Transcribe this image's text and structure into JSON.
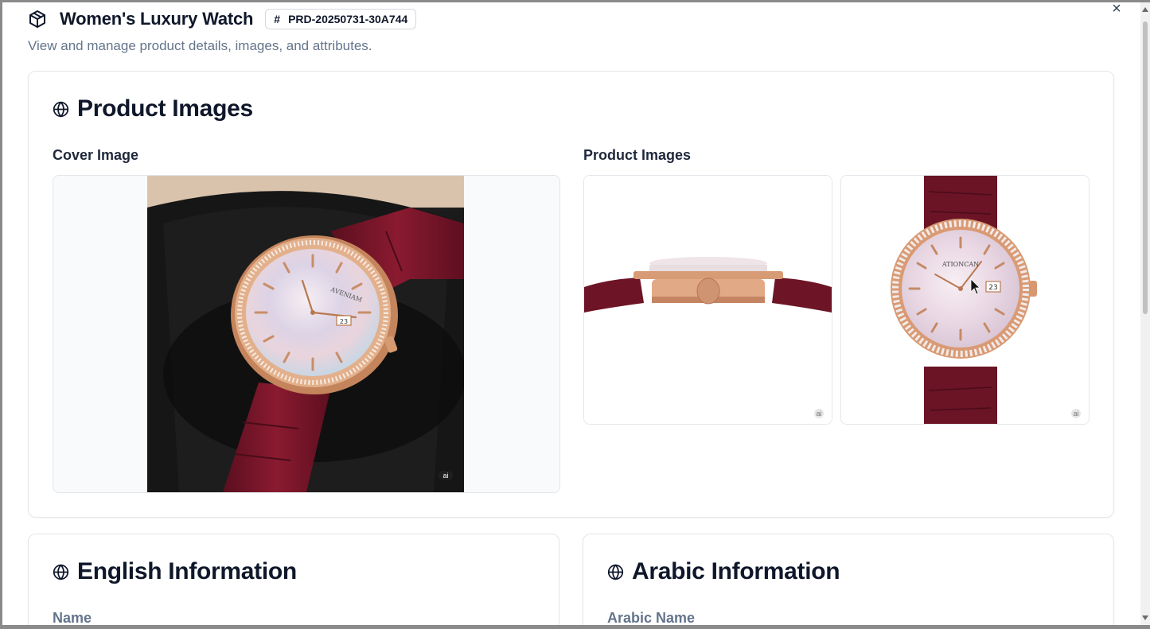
{
  "product": {
    "title": "Women's Luxury Watch",
    "id_badge": "PRD-20250731-30A744",
    "subtitle": "View and manage product details, images, and attributes."
  },
  "images_section": {
    "title": "Product Images",
    "cover_label": "Cover Image",
    "product_images_label": "Product Images",
    "ai_badge": "ai",
    "ai_badge_small": "ai",
    "product_images": [
      {
        "icon": "watch-side-view",
        "ai_badge": "ai"
      },
      {
        "icon": "watch-front-view",
        "ai_badge": "ai",
        "dial_brand": "ATIONCAN",
        "date_window": "23"
      }
    ],
    "cover_dial": {
      "brand": "AVENIAM",
      "date_window": "23"
    }
  },
  "english_section": {
    "title": "English Information",
    "name_label": "Name"
  },
  "arabic_section": {
    "title": "Arabic Information",
    "name_label": "Arabic Name"
  },
  "close_label": "×",
  "colors": {
    "strap": "#7a1428",
    "gold": "#d9a27a",
    "dial": "#ecd9e0"
  }
}
